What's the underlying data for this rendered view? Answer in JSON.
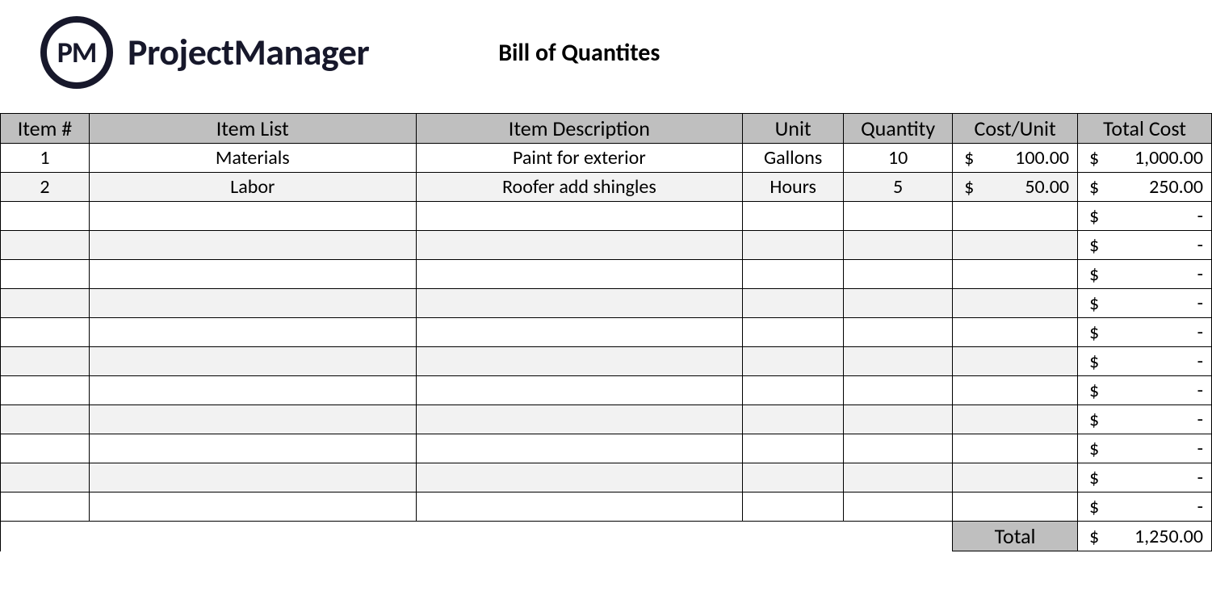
{
  "brand": {
    "logo_badge_text": "PM",
    "logo_text": "ProjectManager"
  },
  "doc_title": "Bill of Quantites",
  "columns": {
    "item_no": "Item #",
    "item_list": "Item List",
    "item_desc": "Item Description",
    "unit": "Unit",
    "qty": "Quantity",
    "cost_unit": "Cost/Unit",
    "total_cost": "Total Cost"
  },
  "currency_symbol": "$",
  "empty_amount": "-",
  "rows": [
    {
      "no": "1",
      "list": "Materials",
      "desc": "Paint for exterior",
      "unit": "Gallons",
      "qty": "10",
      "cost": "100.00",
      "total": "1,000.00"
    },
    {
      "no": "2",
      "list": "Labor",
      "desc": "Roofer add shingles",
      "unit": "Hours",
      "qty": "5",
      "cost": "50.00",
      "total": "250.00"
    },
    {
      "no": "",
      "list": "",
      "desc": "",
      "unit": "",
      "qty": "",
      "cost": "",
      "total": "-"
    },
    {
      "no": "",
      "list": "",
      "desc": "",
      "unit": "",
      "qty": "",
      "cost": "",
      "total": "-"
    },
    {
      "no": "",
      "list": "",
      "desc": "",
      "unit": "",
      "qty": "",
      "cost": "",
      "total": "-"
    },
    {
      "no": "",
      "list": "",
      "desc": "",
      "unit": "",
      "qty": "",
      "cost": "",
      "total": "-"
    },
    {
      "no": "",
      "list": "",
      "desc": "",
      "unit": "",
      "qty": "",
      "cost": "",
      "total": "-"
    },
    {
      "no": "",
      "list": "",
      "desc": "",
      "unit": "",
      "qty": "",
      "cost": "",
      "total": "-"
    },
    {
      "no": "",
      "list": "",
      "desc": "",
      "unit": "",
      "qty": "",
      "cost": "",
      "total": "-"
    },
    {
      "no": "",
      "list": "",
      "desc": "",
      "unit": "",
      "qty": "",
      "cost": "",
      "total": "-"
    },
    {
      "no": "",
      "list": "",
      "desc": "",
      "unit": "",
      "qty": "",
      "cost": "",
      "total": "-"
    },
    {
      "no": "",
      "list": "",
      "desc": "",
      "unit": "",
      "qty": "",
      "cost": "",
      "total": "-"
    },
    {
      "no": "",
      "list": "",
      "desc": "",
      "unit": "",
      "qty": "",
      "cost": "",
      "total": "-"
    }
  ],
  "footer": {
    "label": "Total",
    "value": "1,250.00"
  }
}
